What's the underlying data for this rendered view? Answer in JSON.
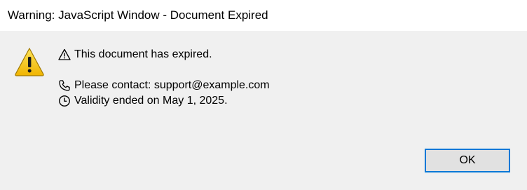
{
  "window": {
    "title": "Warning: JavaScript Window - Document Expired"
  },
  "icons": {
    "main": "warning-triangle-icon",
    "expired_line": "warning-outline-icon",
    "contact_line": "phone-icon",
    "validity_line": "clock-icon"
  },
  "message": {
    "expired": "This document has expired.",
    "contact": "Please contact: support@example.com",
    "validity": "Validity ended on May 1, 2025."
  },
  "buttons": {
    "ok_label": "OK"
  },
  "colors": {
    "focus_border": "#0078d7",
    "warning_fill": "#f5c400"
  }
}
